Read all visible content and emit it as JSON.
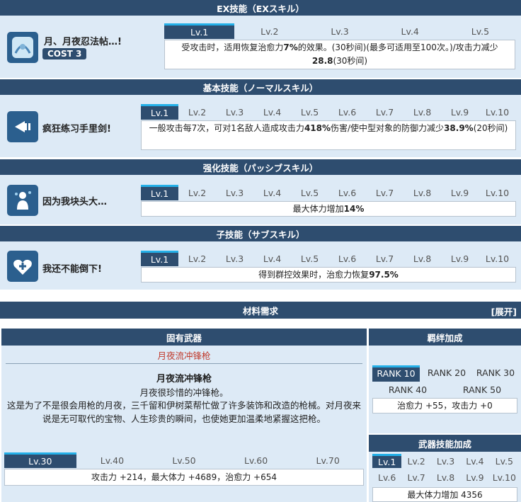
{
  "ex": {
    "header": "EX技能（EXスキル）",
    "name": "月、月夜忍法帖…!",
    "cost": "COST 3",
    "levels": [
      "Lv.1",
      "Lv.2",
      "Lv.3",
      "Lv.4",
      "Lv.5"
    ],
    "desc_pre": "受攻击时，适用恢复治愈力",
    "desc_b1": "7%",
    "desc_mid": "的效果。(30秒间)(最多可适用至100次。)/攻击力减少",
    "desc_b2": "28.8",
    "desc_post": "(30秒间)"
  },
  "basic": {
    "header": "基本技能（ノーマルスキル）",
    "name": "疯狂练习手里剑!",
    "levels": [
      "Lv.1",
      "Lv.2",
      "Lv.3",
      "Lv.4",
      "Lv.5",
      "Lv.6",
      "Lv.7",
      "Lv.8",
      "Lv.9",
      "Lv.10"
    ],
    "desc_pre": "一般攻击每7次，可对1名敌人造成攻击力",
    "desc_b1": "418%",
    "desc_mid": "伤害/使中型对象的防御力减少",
    "desc_b2": "38.9%",
    "desc_post": "(20秒间)"
  },
  "passive": {
    "header": "强化技能（パッシブスキル）",
    "name": "因为我块头大…",
    "levels": [
      "Lv.1",
      "Lv.2",
      "Lv.3",
      "Lv.4",
      "Lv.5",
      "Lv.6",
      "Lv.7",
      "Lv.8",
      "Lv.9",
      "Lv.10"
    ],
    "desc_pre": "最大体力增加",
    "desc_b1": "14%"
  },
  "sub": {
    "header": "子技能（サブスキル）",
    "name": "我还不能倒下!",
    "levels": [
      "Lv.1",
      "Lv.2",
      "Lv.3",
      "Lv.4",
      "Lv.5",
      "Lv.6",
      "Lv.7",
      "Lv.8",
      "Lv.9",
      "Lv.10"
    ],
    "desc_pre": "得到群控效果时，治愈力恢复",
    "desc_b1": "97.5%"
  },
  "materials": {
    "header": "材料需求",
    "expand": "[展开]"
  },
  "weapon": {
    "header": "固有武器",
    "name_red": "月夜流冲锋枪",
    "title": "月夜流冲锋枪",
    "subtitle": "月夜很珍惜的冲锋枪。",
    "desc": "这是为了不是很会用枪的月夜，三千留和伊树菜帮忙做了许多装饰和改造的枪械。对月夜来说是无可取代的宝物、人生珍贵的瞬间，也使她更加温柔地紧握这把枪。",
    "levels": [
      "Lv.30",
      "Lv.40",
      "Lv.50",
      "Lv.60",
      "Lv.70"
    ],
    "stats": "攻击力 +214，最大体力 +4689，治愈力 +654"
  },
  "bond": {
    "header": "羁绊加成",
    "ranks": [
      "RANK 10",
      "RANK 20",
      "RANK 30",
      "RANK 40",
      "RANK 50"
    ],
    "stats": "治愈力 +55，攻击力 +0"
  },
  "weapon_skill": {
    "header": "武器技能加成",
    "levels": [
      "Lv.1",
      "Lv.2",
      "Lv.3",
      "Lv.4",
      "Lv.5",
      "Lv.6",
      "Lv.7",
      "Lv.8",
      "Lv.9",
      "Lv.10"
    ],
    "stats": "最大体力增加 4356"
  },
  "colors": {
    "header": "#2e4d6f",
    "panel": "#ddeaf6",
    "accent": "#24b0e8",
    "weapon_name": "#c0392b"
  }
}
